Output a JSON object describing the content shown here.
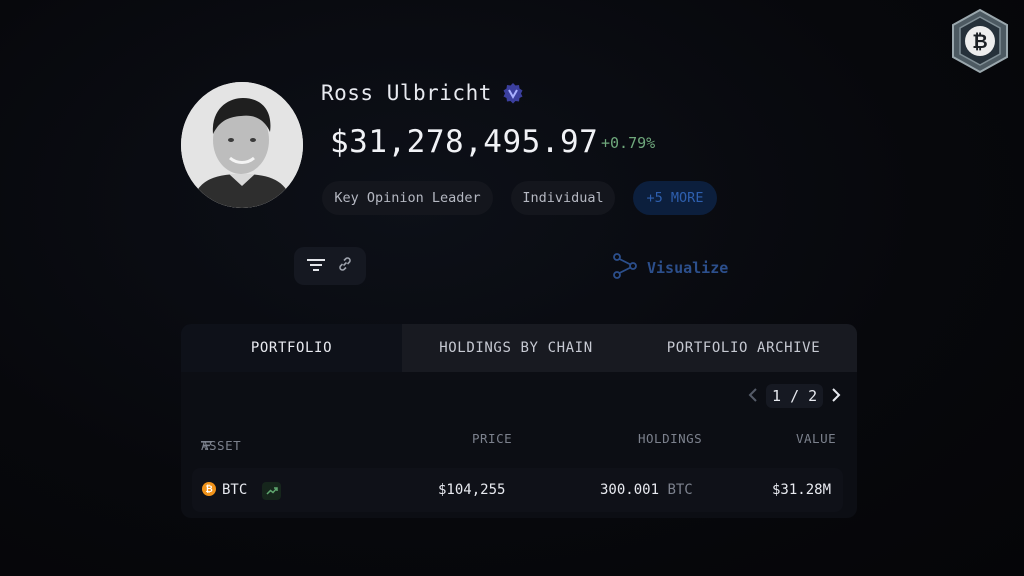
{
  "profile": {
    "name": "Ross Ulbricht",
    "balance": "$31,278,495.97",
    "change": "+0.79%",
    "tags": [
      "Key Opinion Leader",
      "Individual"
    ],
    "more_tag": "+5 MORE"
  },
  "toolbar": {
    "visualize_label": "Visualize"
  },
  "tabs": [
    "PORTFOLIO",
    "HOLDINGS BY CHAIN",
    "PORTFOLIO ARCHIVE"
  ],
  "pagination": {
    "current": "1",
    "separator": "/",
    "total": "2"
  },
  "table": {
    "headers": {
      "asset": "ASSET",
      "price": "PRICE",
      "holdings": "HOLDINGS",
      "value": "VALUE"
    },
    "rows": [
      {
        "asset": "BTC",
        "price": "$104,255",
        "holdings": "300.001",
        "unit": "BTC",
        "value": "$31.28M"
      }
    ]
  },
  "icons": {
    "logo": "bitcoin-shield-logo-icon",
    "verified": "verified-badge-icon",
    "filter": "filter-icon",
    "link": "link-icon",
    "visualize": "graph-nodes-icon",
    "coin": "bitcoin-coin-icon",
    "trend": "trend-up-icon"
  },
  "colors": {
    "positive": "#6fa87c",
    "accent_blue": "#2e5fae",
    "btc_orange": "#f0931a"
  }
}
